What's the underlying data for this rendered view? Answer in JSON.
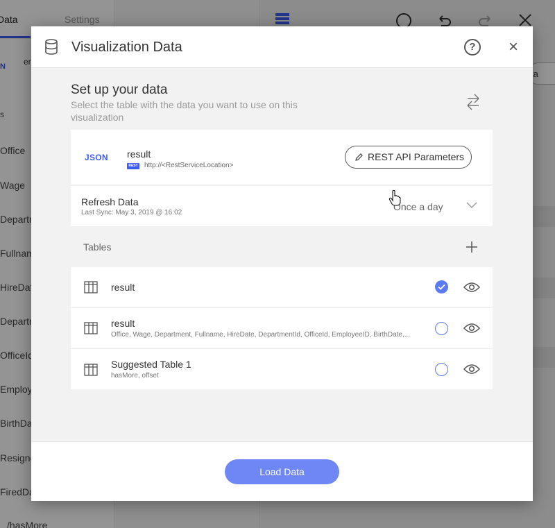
{
  "background": {
    "tabs": [
      "Data",
      "Settings"
    ],
    "source_initials": "N",
    "source_name_fragment": "er",
    "fields": [
      "Office",
      "Wage",
      "Departm",
      "Fullnam",
      "HireDat",
      "Departm",
      "OfficeId",
      "Employ",
      "BirthDa",
      "Resigne",
      "FiredDa"
    ],
    "bottom_text": "/hasMore",
    "pill_fragment": "ta"
  },
  "dialog": {
    "title": "Visualization Data",
    "help_glyph": "?",
    "close_glyph": "×",
    "icons": {
      "header": "database-icon",
      "help": "help-icon",
      "close": "close-icon",
      "swap": "swap-icon",
      "edit": "pencil-icon",
      "expand": "chevron-down-icon",
      "add": "plus-icon",
      "table": "table-icon",
      "preview": "eye-icon"
    },
    "setup": {
      "title": "Set up your data",
      "description": "Select the table with the data you want to use on this visualization"
    },
    "source": {
      "badge": "JSON",
      "name": "result",
      "tag": "REST",
      "url": "http://<RestServiceLocation>",
      "params_button": "REST API Parameters"
    },
    "refresh": {
      "title": "Refresh Data",
      "last_sync": "Last Sync: May 3, 2019 @ 16:02",
      "value": "Once a day"
    },
    "tables_label": "Tables",
    "tables": [
      {
        "name": "result",
        "fields": "",
        "selected": true
      },
      {
        "name": "result",
        "fields": "Office, Wage, Department, Fullname, HireDate, DepartmentId, OfficeId, EmployeeID, BirthDate,...",
        "selected": false
      },
      {
        "name": "Suggested Table 1",
        "fields": "hasMore, offset",
        "selected": false
      }
    ],
    "load_button": "Load Data"
  },
  "colors": {
    "accent": "#3c5bf2",
    "button": "#6f87f5",
    "radio_checked": "#5b7bf2"
  }
}
